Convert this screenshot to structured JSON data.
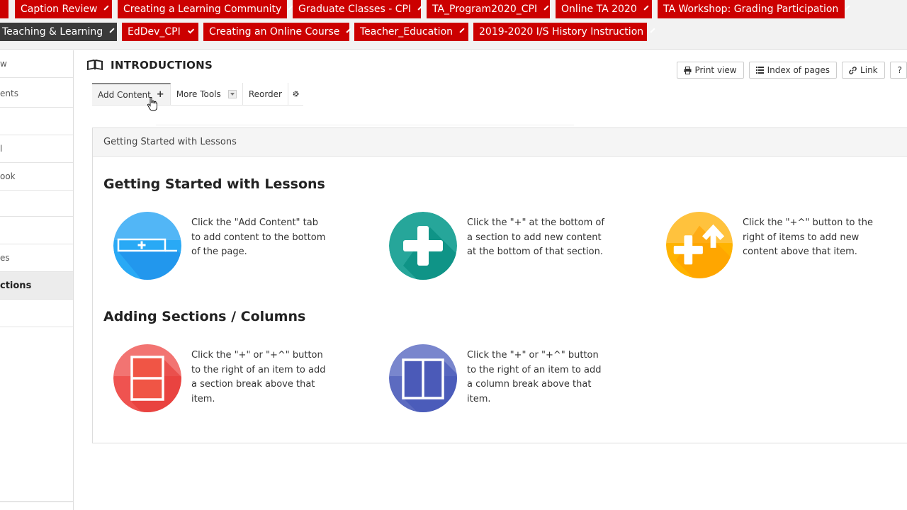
{
  "site_tabs_row1": [
    {
      "label": ""
    },
    {
      "label": "Caption Review"
    },
    {
      "label": "Creating a Learning Community"
    },
    {
      "label": "Graduate Classes - CPI"
    },
    {
      "label": "TA_Program2020_CPI"
    },
    {
      "label": "Online TA 2020"
    },
    {
      "label": "TA Workshop: Grading Participation"
    }
  ],
  "site_tabs_row2": [
    {
      "label": "Teaching & Learning"
    },
    {
      "label": "EdDev_CPI"
    },
    {
      "label": "Creating an Online Course"
    },
    {
      "label": "Teacher_Education"
    },
    {
      "label": "2019-2020 I/S History Instruction"
    }
  ],
  "left_nav": [
    {
      "label": "w"
    },
    {
      "label": "ents"
    },
    {
      "label": ""
    },
    {
      "label": "l"
    },
    {
      "label": "ook"
    },
    {
      "label": ""
    },
    {
      "label": ""
    },
    {
      "label": "es"
    },
    {
      "label": "ctions"
    },
    {
      "label": ""
    }
  ],
  "page": {
    "title": "INTRODUCTIONS",
    "print_view": "Print view",
    "index_of_pages": "Index of pages",
    "link": "Link",
    "help": "?"
  },
  "toolbar": {
    "add_content": "Add Content",
    "add_plus": "+",
    "more_tools": "More Tools",
    "reorder": "Reorder"
  },
  "section": {
    "header": "Getting Started with Lessons",
    "heading1": "Getting Started with Lessons",
    "heading2": "Adding Sections / Columns",
    "features": [
      {
        "icon": "add-content-icon",
        "color": "#2196f3",
        "text": "Click the \"Add Content\" tab to add content to the bottom of the page."
      },
      {
        "icon": "plus-icon",
        "color": "#26a69a",
        "text": "Click the \"+\" at the bottom of a section to add new content at the bottom of that section."
      },
      {
        "icon": "plus-up-icon",
        "color": "#ffb300",
        "text": "Click the \"+^\" button to the right of items to add new content above that item."
      },
      {
        "icon": "section-break-icon",
        "color": "#ef5350",
        "text": "Click the \"+\" or \"+^\" button to the right of an item to add a section break above that item."
      },
      {
        "icon": "column-break-icon",
        "color": "#5c6bc0",
        "text": "Click the \"+\" or \"+^\" button to the right of an item to add a column break above that item."
      }
    ]
  },
  "colors": {
    "site_tab": "#cc0000",
    "site_tab_active": "#3a3a3a"
  }
}
